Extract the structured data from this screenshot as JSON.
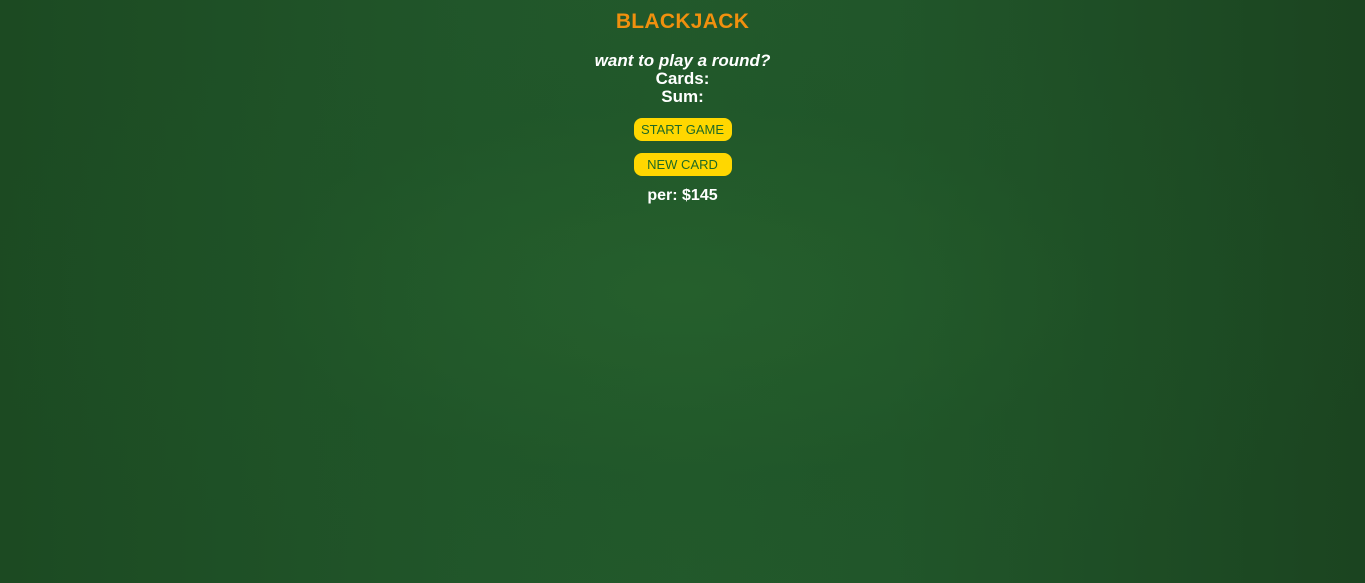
{
  "game": {
    "title": "BLACKJACK",
    "message": "want to play a round?",
    "cards_label": "Cards:",
    "sum_label": "Sum:",
    "start_button": "START GAME",
    "new_card_button": "NEW CARD",
    "player_info": "per: $145"
  },
  "colors": {
    "table_green": "#1f5426",
    "title_orange": "#f0900e",
    "button_yellow": "#ffd700",
    "button_text": "#1f6a25"
  }
}
